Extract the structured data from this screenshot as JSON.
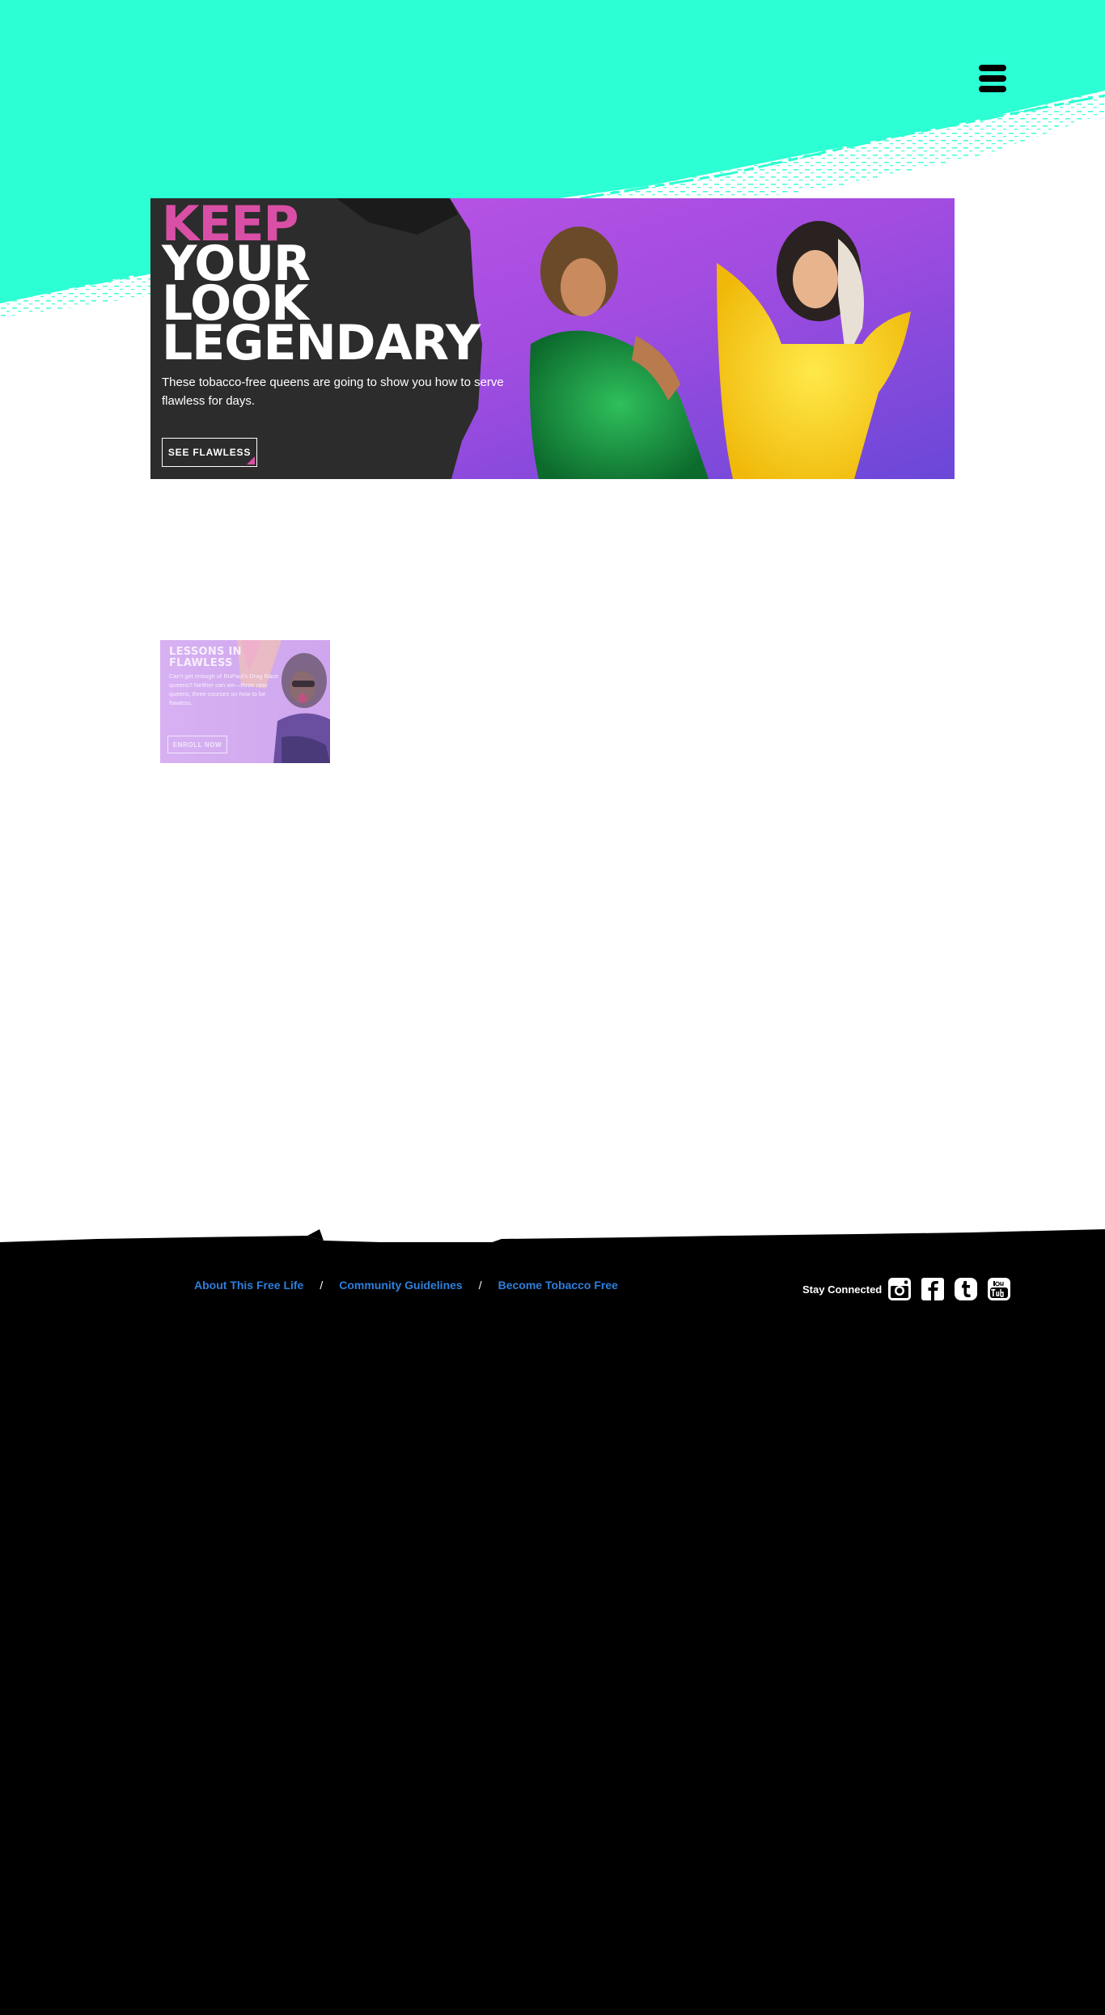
{
  "header": {
    "menu_icon": "hamburger-menu-icon",
    "background_color": "#2cffd3"
  },
  "hero": {
    "heading_lines": [
      "KEEP",
      "YOUR",
      "LOOK",
      "LEGENDARY"
    ],
    "subtext": "These tobacco-free queens are going to show you how to serve flawless for days.",
    "cta_label": "SEE FLAWLESS",
    "accent_color": "#d94fa6"
  },
  "promo": {
    "title": "LESSONS IN FLAWLESS",
    "text": "Can't get enough of RuPaul's Drag Race queens? Neither can we—three new queens, three courses on how to be flawless.",
    "cta_label": "ENROLL NOW"
  },
  "footer": {
    "links": [
      "About This Free Life",
      "Community Guidelines",
      "Become Tobacco Free"
    ],
    "separator": "/",
    "stay_connected": "Stay Connected",
    "social_icons": [
      "instagram-icon",
      "facebook-icon",
      "tumblr-icon",
      "youtube-icon"
    ],
    "link_color": "#2d7fdc"
  }
}
